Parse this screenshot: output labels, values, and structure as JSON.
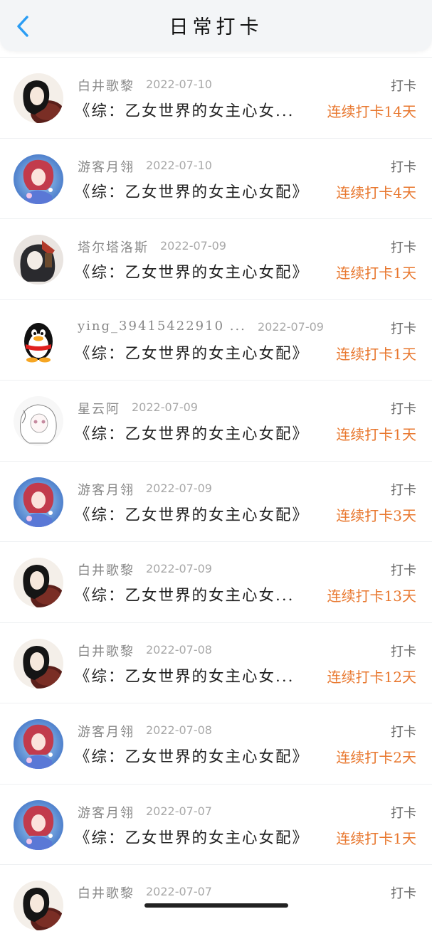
{
  "header": {
    "title": "日常打卡"
  },
  "colors": {
    "accent": "#e8772e",
    "back": "#2a9df4"
  },
  "rows": [
    {
      "avatar": "girl-black-hair",
      "name": "白井歌黎",
      "date": "2022-07-10",
      "action": "打卡",
      "book": "《综：乙女世界的女主心女...",
      "streak": "连续打卡14天"
    },
    {
      "avatar": "girl-red-hair",
      "name": "游客月翎",
      "date": "2022-07-10",
      "action": "打卡",
      "book": "《综：乙女世界的女主心女配》",
      "streak": "连续打卡4天"
    },
    {
      "avatar": "girl-dark-ornate",
      "name": "塔尔塔洛斯",
      "date": "2022-07-09",
      "action": "打卡",
      "book": "《综：乙女世界的女主心女配》",
      "streak": "连续打卡1天"
    },
    {
      "avatar": "qq-penguin",
      "name": "ying_39415422910 ...",
      "date": "2022-07-09",
      "action": "打卡",
      "book": "《综：乙女世界的女主心女配》",
      "streak": "连续打卡1天"
    },
    {
      "avatar": "girl-white-sketch",
      "name": "星云阿",
      "date": "2022-07-09",
      "action": "打卡",
      "book": "《综：乙女世界的女主心女配》",
      "streak": "连续打卡1天"
    },
    {
      "avatar": "girl-red-hair",
      "name": "游客月翎",
      "date": "2022-07-09",
      "action": "打卡",
      "book": "《综：乙女世界的女主心女配》",
      "streak": "连续打卡3天"
    },
    {
      "avatar": "girl-black-hair",
      "name": "白井歌黎",
      "date": "2022-07-09",
      "action": "打卡",
      "book": "《综：乙女世界的女主心女...",
      "streak": "连续打卡13天"
    },
    {
      "avatar": "girl-black-hair",
      "name": "白井歌黎",
      "date": "2022-07-08",
      "action": "打卡",
      "book": "《综：乙女世界的女主心女...",
      "streak": "连续打卡12天"
    },
    {
      "avatar": "girl-red-hair",
      "name": "游客月翎",
      "date": "2022-07-08",
      "action": "打卡",
      "book": "《综：乙女世界的女主心女配》",
      "streak": "连续打卡2天"
    },
    {
      "avatar": "girl-red-hair",
      "name": "游客月翎",
      "date": "2022-07-07",
      "action": "打卡",
      "book": "《综：乙女世界的女主心女配》",
      "streak": "连续打卡1天"
    },
    {
      "avatar": "girl-black-hair",
      "name": "白井歌黎",
      "date": "2022-07-07",
      "action": "打卡",
      "book": "",
      "streak": ""
    }
  ]
}
